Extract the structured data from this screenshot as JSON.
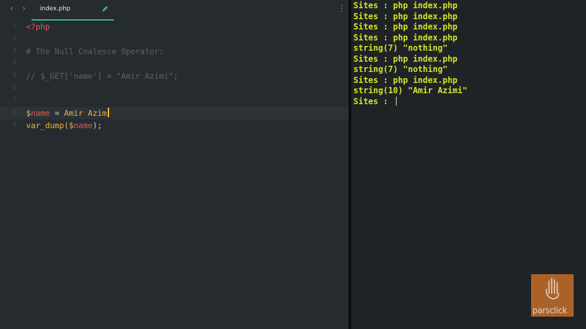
{
  "editor": {
    "tab": {
      "filename": "index.php"
    },
    "lines": [
      {
        "num": "1",
        "text": "<?php"
      },
      {
        "num": "2",
        "text": ""
      },
      {
        "num": "3",
        "text": "# The Null Coalesce Operator:"
      },
      {
        "num": "4",
        "text": ""
      },
      {
        "num": "5",
        "text": "// $_GET['name'] = \"Amir Azimi\";"
      },
      {
        "num": "6",
        "text": ""
      },
      {
        "num": "7",
        "text": ""
      },
      {
        "num": "8",
        "dollar": "$",
        "var": "name",
        "op": " = ",
        "value": "Amir Azim"
      },
      {
        "num": "9",
        "func": "var_dump(",
        "dollar": "$",
        "var": "name",
        "end": ");"
      }
    ]
  },
  "terminal": {
    "lines": [
      "Sites : php index.php",
      "Sites : php index.php",
      "Sites : php index.php",
      "Sites : php index.php",
      "string(7) \"nothing\"",
      "Sites : php index.php",
      "string(7) \"nothing\"",
      "Sites : php index.php",
      "string(10) \"Amir Azimi\"",
      "Sites : "
    ]
  },
  "watermark": {
    "text": "parsclick"
  },
  "icons": {
    "back": "chevron-left-icon",
    "forward": "chevron-right-icon",
    "edit": "pencil-icon",
    "more": "more-vertical-icon"
  },
  "colors": {
    "editor_bg": "#262b30",
    "terminal_bg": "#1e2326",
    "tab_accent": "#2fb89c",
    "terminal_text": "#d8e22a",
    "cursor": "#f0c420"
  }
}
